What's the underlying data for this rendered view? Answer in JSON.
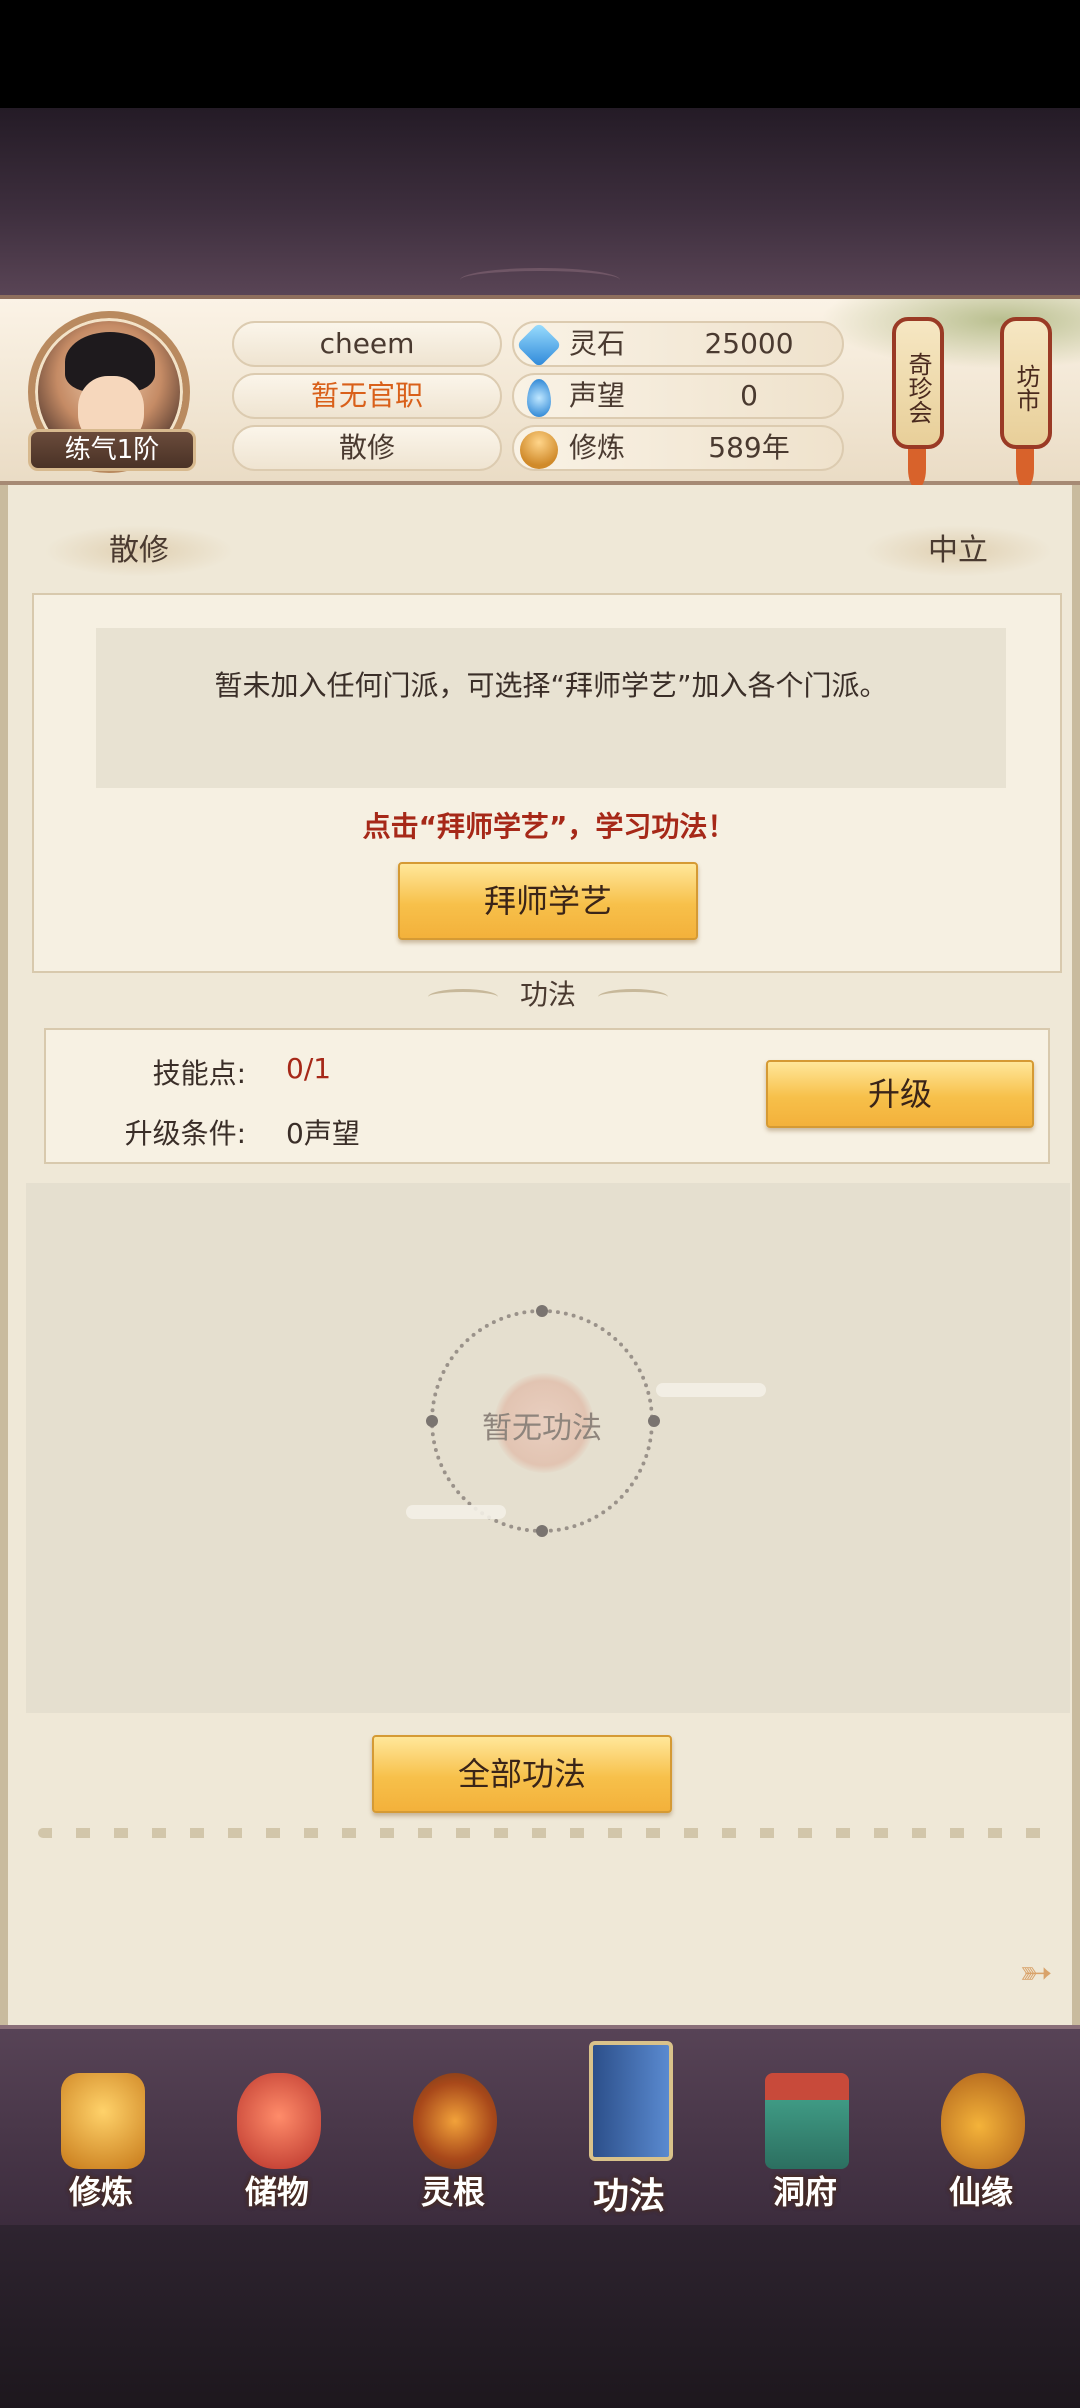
{
  "player": {
    "name": "cheem",
    "office": "暂无官职",
    "sect": "散修",
    "rank": "练气1阶"
  },
  "stats": [
    {
      "label": "灵石",
      "value": "25000",
      "icon": "spirit-stone-icon"
    },
    {
      "label": "声望",
      "value": "0",
      "icon": "reputation-icon"
    },
    {
      "label": "修炼",
      "value": "589年",
      "icon": "cultivation-icon"
    }
  ],
  "side_buttons": {
    "treasure_fair": "奇珍会",
    "market": "坊市"
  },
  "sect_panel": {
    "sect_tag": "散修",
    "alignment_tag": "中立",
    "message": "暂未加入任何门派，可选择“拜师学艺”加入各个门派。",
    "hint": "点击“拜师学艺”，学习功法！",
    "apprentice_button": "拜师学艺"
  },
  "skills": {
    "section_title": "功法",
    "points_label": "技能点:",
    "points_value": "0/1",
    "upgrade_cond_label": "升级条件:",
    "upgrade_cond_value": "0声望",
    "upgrade_button": "升级",
    "empty_text": "暂无功法",
    "all_skills_button": "全部功法"
  },
  "nav": [
    {
      "label": "修炼",
      "icon": "cultivation-nav-icon",
      "color": "#e6a23c"
    },
    {
      "label": "储物",
      "icon": "storage-bag-icon",
      "color": "#d84a3a"
    },
    {
      "label": "灵根",
      "icon": "spirit-root-icon",
      "color": "#c85a1e"
    },
    {
      "label": "功法",
      "icon": "skill-book-icon",
      "color": "#3b6fb8"
    },
    {
      "label": "洞府",
      "icon": "cave-dwelling-icon",
      "color": "#4a9a7a"
    },
    {
      "label": "仙缘",
      "icon": "immortal-fate-icon",
      "color": "#d98a2a"
    }
  ],
  "colors": {
    "accent_gold": "#f7c04a",
    "hint_red": "#a62818",
    "office_orange": "#d9601a"
  }
}
